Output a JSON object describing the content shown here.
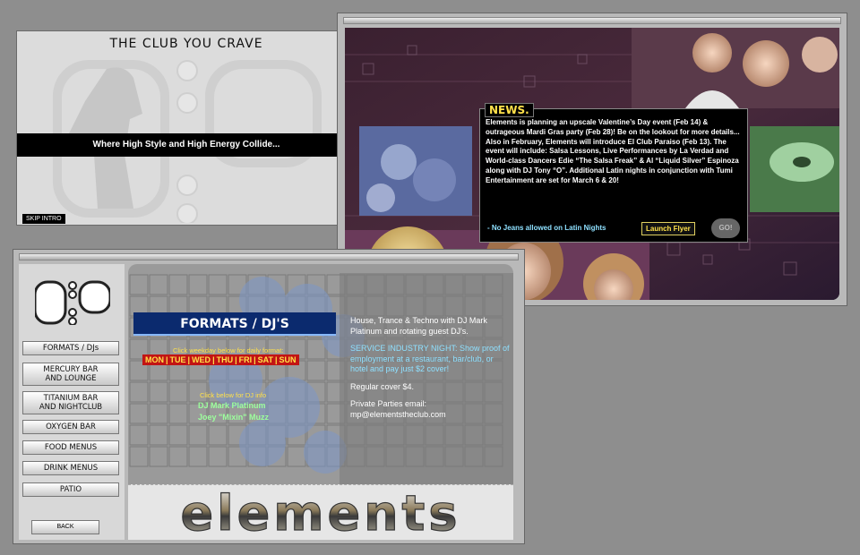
{
  "intro": {
    "title": "THE CLUB YOU CRAVE",
    "tagline": "Where High Style and High Energy Collide...",
    "skip_label": "SKIP INTRO",
    "logo_text": "elements"
  },
  "news": {
    "label": "NEWS.",
    "body": "Elements is planning an upscale Valentine’s Day event (Feb 14) & outrageous Mardi Gras party (Feb 28)!  Be on the lookout for more details... Also in February, Elements will introduce El Club Paraiso (Feb 13).  The event will include: Salsa Lessons, Live Performances by La Verdad and World-class Dancers Edie “The Salsa Freak” & Al “Liquid Silver” Espinoza along with DJ Tony “O”.  Additional Latin nights in conjunction with Tumi Entertainment are set for March 6 & 20!",
    "note": "- No Jeans allowed on Latin Nights",
    "launch_label": "Launch Flyer",
    "go_label": "GO!"
  },
  "nav": {
    "items": [
      {
        "label": "FORMATS / DJs",
        "line2": ""
      },
      {
        "label": "MERCURY BAR",
        "line2": "AND LOUNGE"
      },
      {
        "label": "TITANIUM BAR",
        "line2": "AND NIGHTCLUB"
      },
      {
        "label": "OXYGEN BAR",
        "line2": ""
      },
      {
        "label": "FOOD MENUS",
        "line2": ""
      },
      {
        "label": "DRINK MENUS",
        "line2": ""
      },
      {
        "label": "PATIO",
        "line2": ""
      }
    ],
    "back_label": "BACK"
  },
  "formats": {
    "title": "FORMATS / DJ'S",
    "click_weekday": "Click weekday below for daily format:",
    "days": [
      "MON",
      "TUE",
      "WED",
      "THU",
      "FRI",
      "SAT",
      "SUN"
    ],
    "click_dj": "Click  below for DJ info",
    "djs": [
      "DJ Mark Platinum",
      "Joey \"Mixin\" Muzz"
    ],
    "text1": "House, Trance & Techno with DJ Mark Platinum and rotating guest DJ's.",
    "service": "SERVICE INDUSTRY NIGHT: Show proof of employment at a restaurant, bar/club, or hotel and pay just $2 cover!",
    "cover": "Regular cover $4.",
    "private_label": "Private Parties email:",
    "private_email": "mp@elementstheclub.com",
    "brand": "elements"
  },
  "colors": {
    "news_yellow": "#ffe14a",
    "dj_green": "#9cff9c",
    "service_blue": "#8ee0ff",
    "title_navy": "#0b2a6e",
    "days_red": "#c21414"
  }
}
